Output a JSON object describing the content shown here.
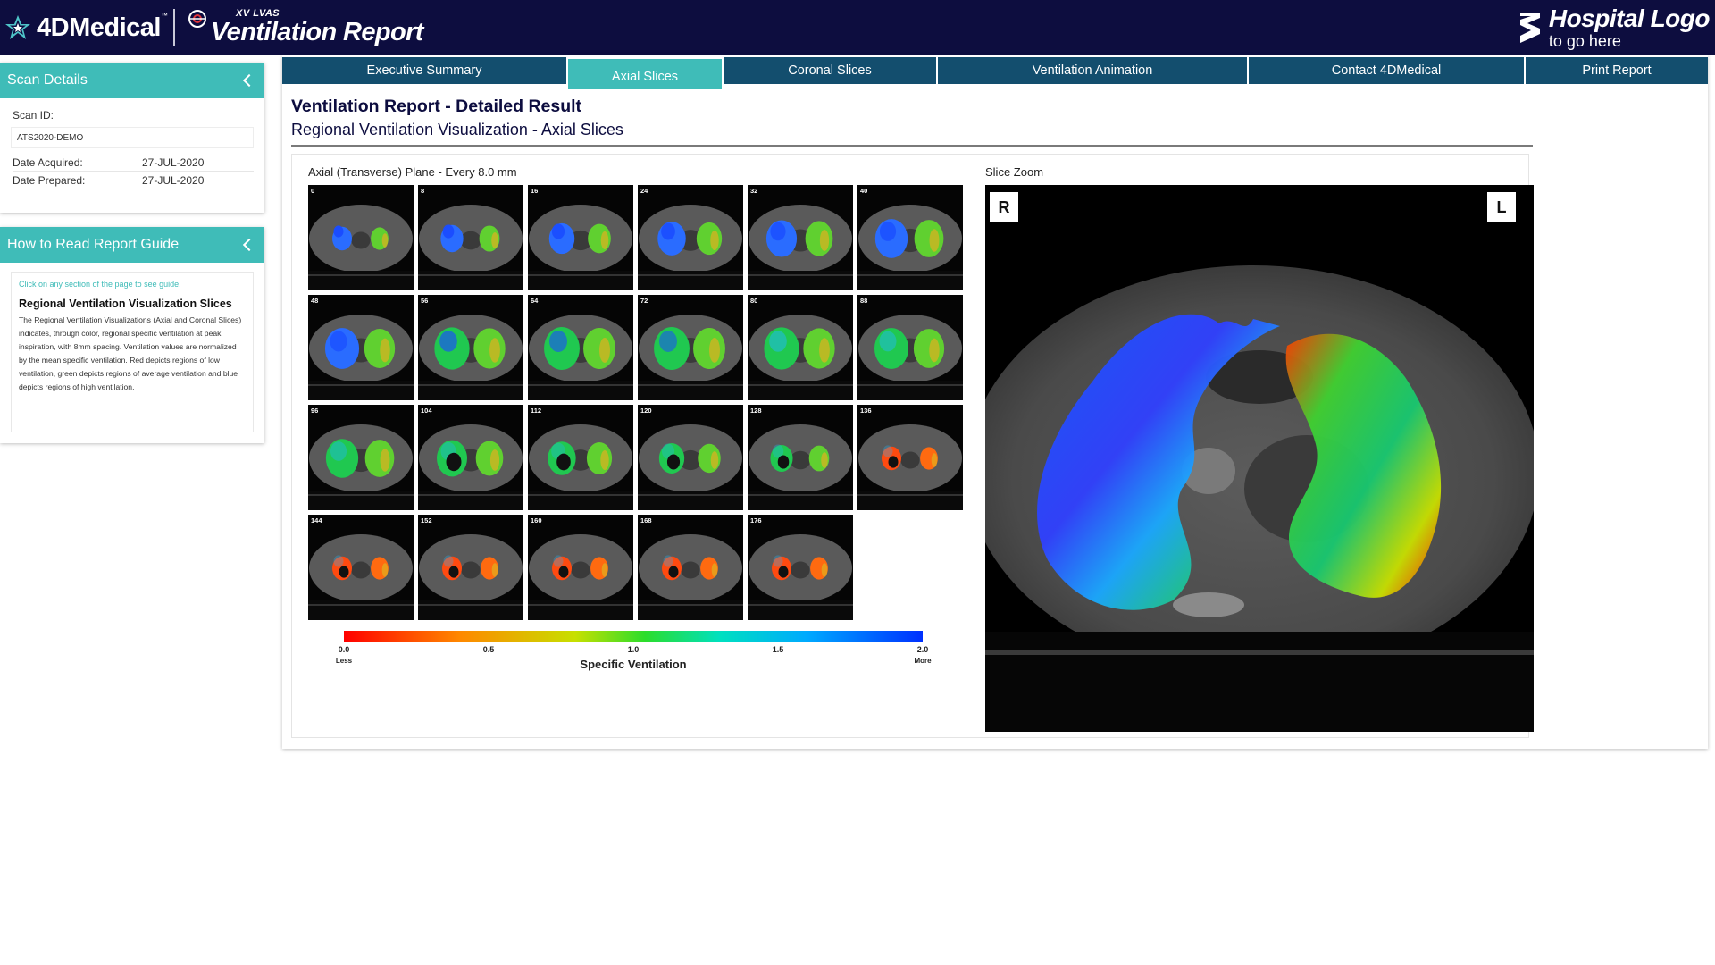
{
  "header": {
    "brand": "4DMedical",
    "brand_tm": "™",
    "product_tag": "XV LVAS",
    "product_name": "Ventilation Report",
    "hospital_logo_title": "Hospital Logo",
    "hospital_logo_sub": "to go here"
  },
  "sidebar": {
    "scan_details": {
      "title": "Scan Details",
      "scan_id_label": "Scan ID:",
      "scan_id_value": "ATS2020-DEMO",
      "rows": [
        {
          "label": "Date Acquired:",
          "value": "27-JUL-2020"
        },
        {
          "label": "Date Prepared:",
          "value": "27-JUL-2020"
        }
      ]
    },
    "guide": {
      "title": "How to Read Report Guide",
      "hint": "Click on any section of the page to see guide.",
      "heading": "Regional Ventilation Visualization Slices",
      "body": "The Regional Ventilation Visualizations (Axial and Coronal Slices) indicates, through color, regional specific ventilation at peak inspiration, with 8mm spacing. Ventilation values are normalized by the mean specific ventilation. Red depicts regions of low ventilation, green depicts regions of average ventilation and blue depicts regions of high ventilation."
    }
  },
  "tabs": [
    {
      "label": "Executive Summary",
      "active": false
    },
    {
      "label": "Axial Slices",
      "active": true
    },
    {
      "label": "Coronal Slices",
      "active": false
    },
    {
      "label": "Ventilation Animation",
      "active": false
    },
    {
      "label": "Contact 4DMedical",
      "active": false
    },
    {
      "label": "Print Report",
      "active": false
    }
  ],
  "main": {
    "title": "Ventilation Report - Detailed Result",
    "subtitle": "Regional Ventilation Visualization - Axial Slices",
    "plane_label": "Axial (Transverse) Plane - Every 8.0 mm",
    "zoom_label": "Slice Zoom",
    "orientation_right": "R",
    "orientation_left": "L",
    "slices": [
      "0",
      "8",
      "16",
      "24",
      "32",
      "40",
      "48",
      "56",
      "64",
      "72",
      "80",
      "88",
      "96",
      "104",
      "112",
      "120",
      "128",
      "136",
      "144",
      "152",
      "160",
      "168",
      "176"
    ]
  },
  "scale": {
    "title": "Specific Ventilation",
    "ticks": [
      "0.0",
      "0.5",
      "1.0",
      "1.5",
      "2.0"
    ],
    "low_label": "Less",
    "high_label": "More"
  }
}
